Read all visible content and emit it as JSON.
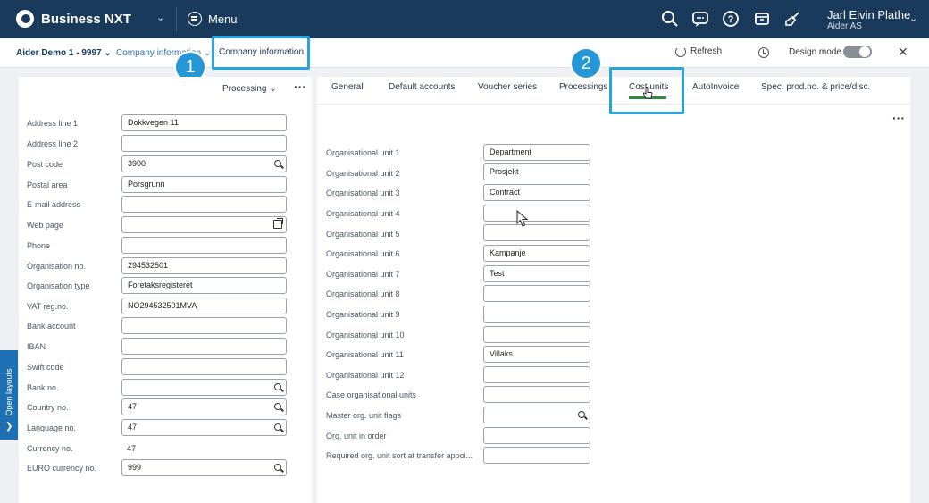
{
  "topbar": {
    "app_name": "Business NXT",
    "menu_label": "Menu",
    "user_name": "Jarl Eivin Plathe",
    "company": "Aider AS",
    "icons": [
      "search-icon",
      "chat-icon",
      "help-icon",
      "inbox-icon",
      "broom-icon"
    ]
  },
  "breadcrumb": {
    "company": "Aider Demo 1 - 9997",
    "section": "Company information",
    "current": "Company information"
  },
  "toolbar": {
    "refresh_label": "Refresh",
    "design_mode_label": "Design mode",
    "design_mode_on": false
  },
  "badges": {
    "one": "1",
    "two": "2"
  },
  "sidebar": {
    "open_layouts_label": "Open layouts"
  },
  "left_panel": {
    "processing_label": "Processing",
    "fields": [
      {
        "label": "Address line 1",
        "value": "Dokkvegen 11"
      },
      {
        "label": "Address line 2",
        "value": ""
      },
      {
        "label": "Post code",
        "value": "3900"
      },
      {
        "label": "Postal area",
        "value": "Porsgrunn"
      },
      {
        "label": "E-mail address",
        "value": ""
      },
      {
        "label": "Web page",
        "value": ""
      },
      {
        "label": "Phone",
        "value": ""
      },
      {
        "label": "Organisation no.",
        "value": "294532501"
      },
      {
        "label": "Organisation type",
        "value": "Foretaksregisteret"
      },
      {
        "label": "VAT reg.no.",
        "value": "NO294532501MVA"
      },
      {
        "label": "Bank account",
        "value": ""
      },
      {
        "label": "IBAN",
        "value": ""
      },
      {
        "label": "Swift code",
        "value": ""
      },
      {
        "label": "Bank no.",
        "value": ""
      },
      {
        "label": "Country no.",
        "value": "47"
      },
      {
        "label": "Language no.",
        "value": "47"
      },
      {
        "label": "Currency no.",
        "value": "47"
      },
      {
        "label": "EURO currency no.",
        "value": "999"
      }
    ]
  },
  "tabs": [
    {
      "label": "General"
    },
    {
      "label": "Default accounts"
    },
    {
      "label": "Voucher series"
    },
    {
      "label": "Processings"
    },
    {
      "label": "Cost units",
      "active": true
    },
    {
      "label": "AutoInvoice"
    },
    {
      "label": "Spec. prod.no. & price/disc."
    }
  ],
  "cost_units": {
    "fields": [
      {
        "label": "Organisational unit 1",
        "value": "Department"
      },
      {
        "label": "Organisational unit 2",
        "value": "Prosjekt"
      },
      {
        "label": "Organisational unit 3",
        "value": "Contract"
      },
      {
        "label": "Organisational unit 4",
        "value": ""
      },
      {
        "label": "Organisational unit 5",
        "value": ""
      },
      {
        "label": "Organisational unit 6",
        "value": "Kampanje"
      },
      {
        "label": "Organisational unit 7",
        "value": "Test"
      },
      {
        "label": "Organisational unit 8",
        "value": ""
      },
      {
        "label": "Organisational unit 9",
        "value": ""
      },
      {
        "label": "Organisational unit 10",
        "value": ""
      },
      {
        "label": "Organisational unit 11",
        "value": "Villaks"
      },
      {
        "label": "Organisational unit 12",
        "value": ""
      },
      {
        "label": "Case organisational units",
        "value": ""
      },
      {
        "label": "Master org. unit flags",
        "value": ""
      },
      {
        "label": "Org. unit in order",
        "value": ""
      },
      {
        "label": "Required org. unit sort at transfer appoi...",
        "value": ""
      }
    ]
  },
  "colors": {
    "topbar_bg": "#1a3a5c",
    "highlight": "#29a3dc",
    "active_tab_underline": "#2e8b3e",
    "badge_bg": "#2596d6"
  }
}
